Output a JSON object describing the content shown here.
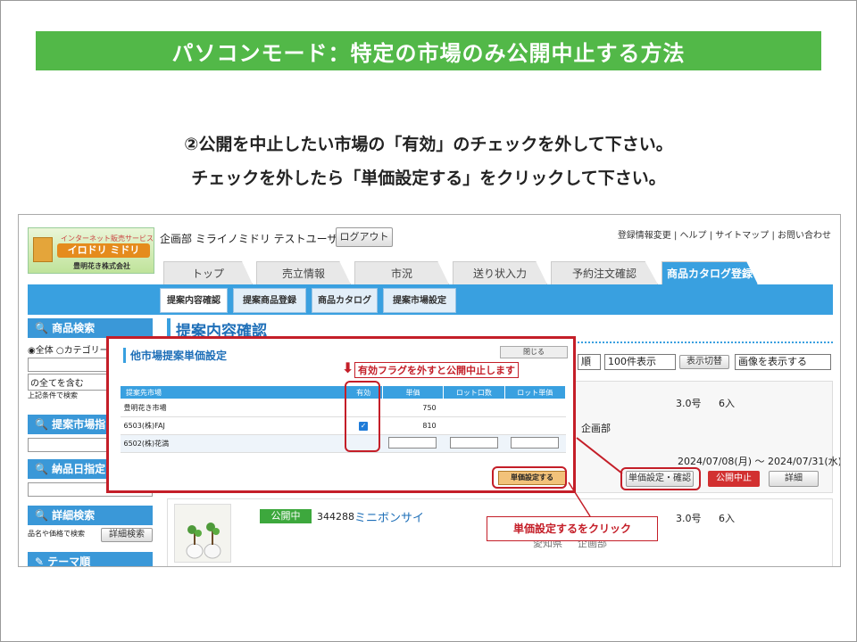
{
  "slide": {
    "title": "パソコンモード：特定の市場のみ公開中止する方法",
    "instruction_line1": "②公開を中止したい市場の「有効」のチェックを外して下さい。",
    "instruction_line2": "チェックを外したら「単価設定する」をクリックして下さい。"
  },
  "header": {
    "logo_top": "インターネット販売サービス",
    "logo_main": "イロドリ ミドリ",
    "logo_company": "豊明花き株式会社",
    "user_text": "企画部 ミライノミドリ テストユーザ様",
    "logout_label": "ログアウト",
    "top_links": "登録情報変更 | ヘルプ | サイトマップ | お問い合わせ"
  },
  "tabs": [
    "トップ",
    "売立情報",
    "市況",
    "送り状入力",
    "予約注文確認",
    "商品カタログ登録"
  ],
  "subtabs": [
    "提案内容確認",
    "提案商品登録",
    "商品カタログ",
    "提案市場設定"
  ],
  "sidebar": {
    "product_search": "商品検索",
    "radio_all": "全体",
    "radio_category": "カテゴリー",
    "include_all": "の全てを含む",
    "cond_search": "上記条件で検索",
    "market_search": "提案市場指",
    "delivery_search": "納品日指定",
    "detail_search": "詳細検索",
    "detail_hint": "品名や価格で検索",
    "detail_search_button": "詳細検索",
    "theme": "テーマ順"
  },
  "main": {
    "page_title": "提案内容確認",
    "order_select": "順",
    "count_select": "100件表示",
    "display_switch": "表示切替",
    "image_select": "画像を表示する",
    "row1": {
      "size": "3.0号",
      "qty": "6入",
      "dept": "企画部",
      "dates": "2024/07/08(月) 〜 2024/07/31(水)"
    },
    "actions": {
      "price_setting": "単価設定・確認",
      "stop": "公開中止",
      "detail": "詳細"
    },
    "row2": {
      "status": "公開中",
      "code": "344288",
      "name": "ミニボンサイ",
      "size": "3.0号",
      "qty": "6入",
      "origin": "愛知県",
      "dept": "企画部"
    }
  },
  "modal": {
    "title": "他市場提案単価設定",
    "close_label": "閉じる",
    "columns": [
      "提案先市場",
      "有効",
      "単価",
      "ロット口数",
      "ロット単価"
    ],
    "rows": [
      {
        "market": "豊明花き市場",
        "checked": false,
        "price": "750"
      },
      {
        "market": "6503(株)FAJ",
        "checked": true,
        "price": "810"
      },
      {
        "market": "6502(株)花満",
        "checked": false,
        "price": ""
      }
    ],
    "submit_label": "単価設定する"
  },
  "callouts": {
    "flag_note": "有効フラグを外すと公開中止します",
    "click_note": "単価設定するをクリック"
  },
  "colors": {
    "green": "#52b848",
    "blue": "#39a0e0",
    "red": "#c41e28"
  }
}
